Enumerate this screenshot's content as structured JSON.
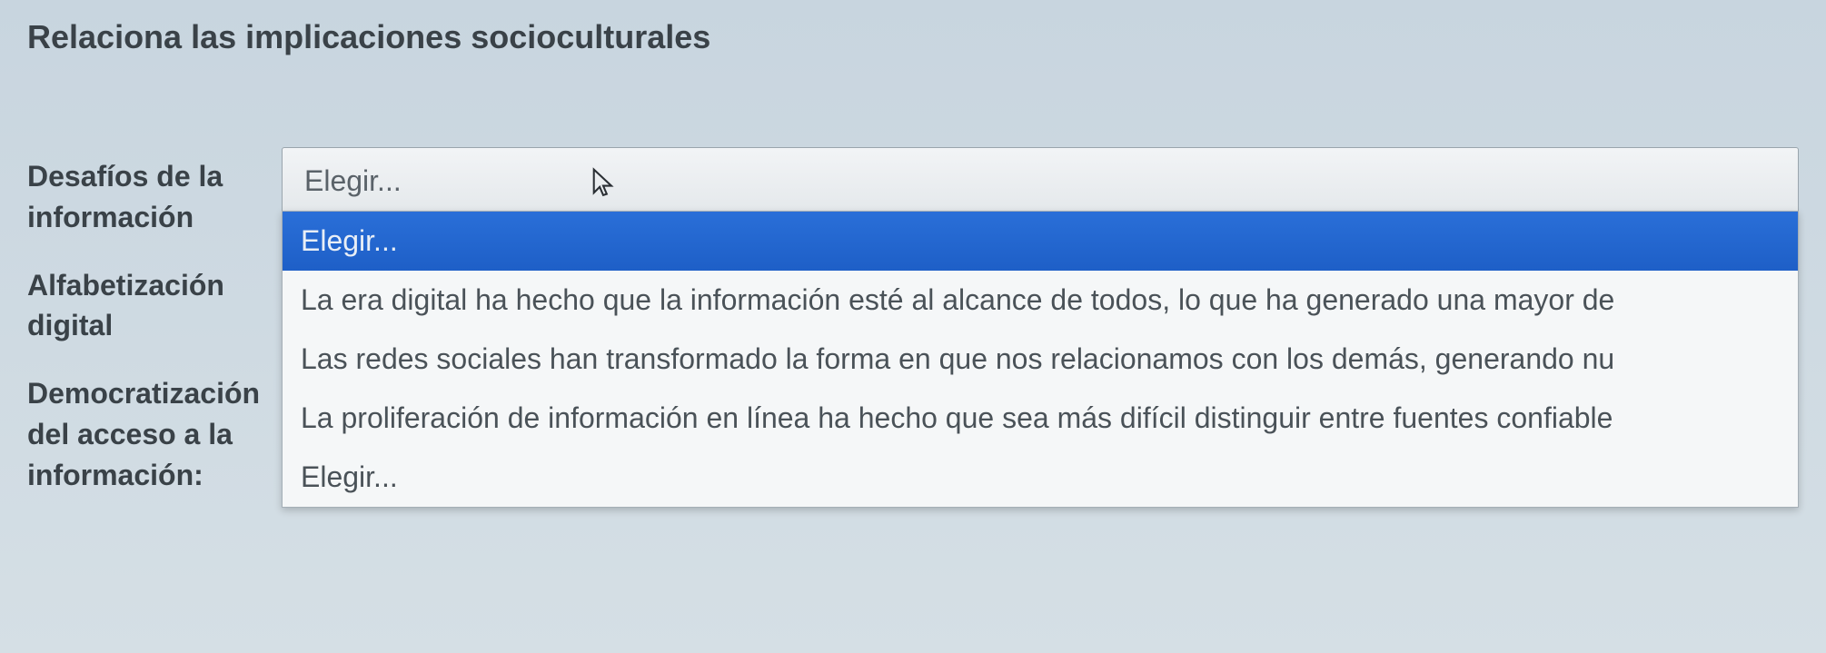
{
  "title": "Relaciona las implicaciones socioculturales",
  "labels": {
    "row1": "Desafíos de la información",
    "row2": "Alfabetización digital",
    "row3": "Democratización del acceso a la información:"
  },
  "select": {
    "placeholder": "Elegir...",
    "options": {
      "opt0": "Elegir...",
      "opt1": "La era digital ha hecho que la información esté al alcance de todos, lo que ha generado una mayor de",
      "opt2": "Las redes sociales han transformado la forma en que nos relacionamos con los demás, generando nu",
      "opt3": "La proliferación de información en línea ha hecho que sea más difícil distinguir entre fuentes confiable"
    }
  },
  "below_placeholder": "Elegir..."
}
